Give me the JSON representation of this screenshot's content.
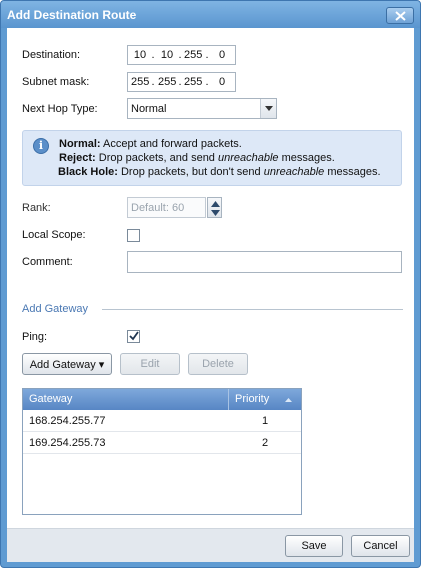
{
  "dialog": {
    "title": "Add Destination Route",
    "close_icon": "close-icon"
  },
  "form": {
    "destination": {
      "label": "Destination:",
      "octets": [
        "10",
        "10",
        "255",
        "0"
      ],
      "separator": "."
    },
    "subnet": {
      "label": "Subnet mask:",
      "octets": [
        "255",
        "255",
        "255",
        "0"
      ],
      "separator": "."
    },
    "next_hop": {
      "label": "Next Hop Type:",
      "value": "Normal",
      "arrow_icon": "chevron-down-icon"
    },
    "info": {
      "icon": "info-icon",
      "lines": [
        {
          "term": "Normal:",
          "pre": " Accept and forward packets.",
          "em": "",
          "post": ""
        },
        {
          "term": "Reject:",
          "pre": " Drop packets, and send ",
          "em": "unreachable",
          "post": " messages."
        },
        {
          "term": "Black Hole:",
          "pre": " Drop packets, but don't send ",
          "em": "unreachable",
          "post": " messages."
        }
      ]
    },
    "rank": {
      "label": "Rank:",
      "placeholder": "Default: 60",
      "enabled": false
    },
    "local_scope": {
      "label": "Local Scope:",
      "checked": false
    },
    "comment": {
      "label": "Comment:",
      "value": ""
    }
  },
  "gateway_section": {
    "title": "Add Gateway",
    "ping": {
      "label": "Ping:",
      "checked": true
    },
    "buttons": {
      "add": "Add Gateway ▾",
      "edit": "Edit",
      "delete": "Delete"
    },
    "table": {
      "columns": [
        "Gateway",
        "Priority"
      ],
      "sort_icon": "sort-ascending-icon",
      "rows": [
        {
          "gateway": "168.254.255.77",
          "priority": "1"
        },
        {
          "gateway": "169.254.255.73",
          "priority": "2"
        }
      ]
    }
  },
  "footer": {
    "save": "Save",
    "cancel": "Cancel"
  },
  "colors": {
    "title_bar": "#5a95cf",
    "info_bg": "#dde8f7",
    "section_title": "#4a78b3",
    "grid_header": "#5786c4"
  }
}
